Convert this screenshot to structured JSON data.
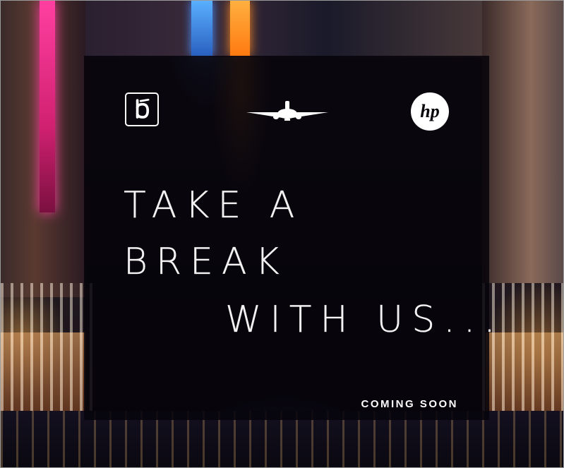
{
  "headline": {
    "line1": "TAKE A",
    "line2": "BREAK",
    "line3": "WITH US..."
  },
  "footer": {
    "coming_soon": "COMING SOON"
  },
  "logos": {
    "left": "brand-b-logo-icon",
    "center": "airplane-icon",
    "right": "hp-logo"
  },
  "hp_logo_text": "hp",
  "colors": {
    "panel": "#06040a",
    "text": "#f2f2f2",
    "neon_pink": "#ff3fa0",
    "neon_orange": "#ff8a20"
  }
}
